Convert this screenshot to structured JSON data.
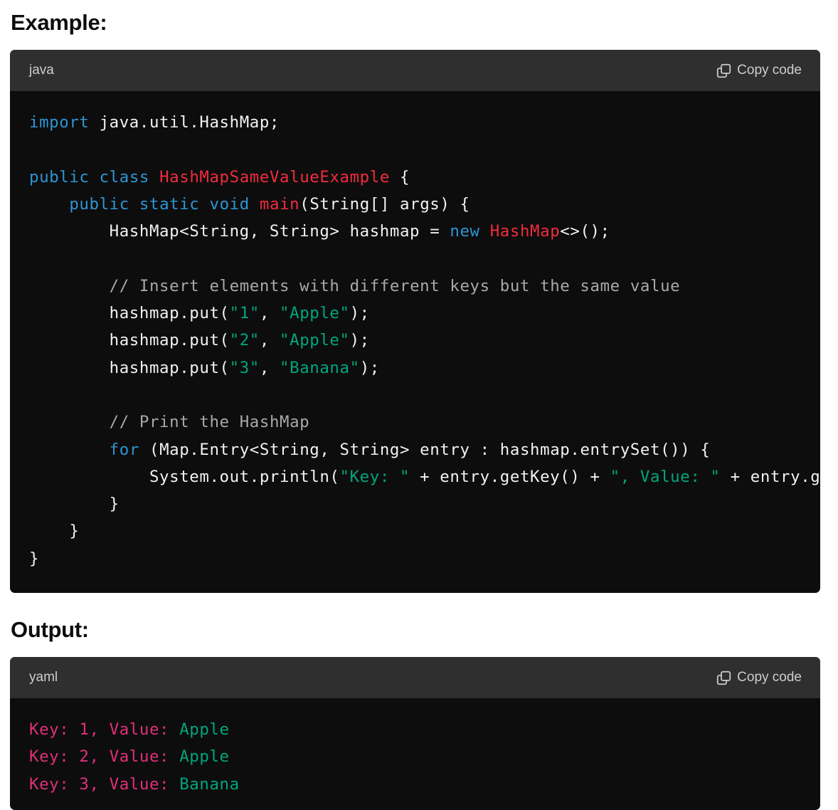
{
  "sections": {
    "example_heading": "Example:",
    "output_heading": "Output:"
  },
  "java_block": {
    "language": "java",
    "copy_label": "Copy code",
    "lines": [
      [
        {
          "t": "import",
          "c": "kw"
        },
        {
          "t": " java.util.HashMap;",
          "c": ""
        }
      ],
      [],
      [
        {
          "t": "public",
          "c": "kw"
        },
        {
          "t": " ",
          "c": ""
        },
        {
          "t": "class",
          "c": "kw"
        },
        {
          "t": " ",
          "c": ""
        },
        {
          "t": "HashMapSameValueExample",
          "c": "cls"
        },
        {
          "t": " {",
          "c": ""
        }
      ],
      [
        {
          "t": "    ",
          "c": ""
        },
        {
          "t": "public",
          "c": "kw"
        },
        {
          "t": " ",
          "c": ""
        },
        {
          "t": "static",
          "c": "kw"
        },
        {
          "t": " ",
          "c": ""
        },
        {
          "t": "void",
          "c": "kw"
        },
        {
          "t": " ",
          "c": ""
        },
        {
          "t": "main",
          "c": "cls"
        },
        {
          "t": "(String[] args) {",
          "c": ""
        }
      ],
      [
        {
          "t": "        HashMap<String, String> hashmap = ",
          "c": ""
        },
        {
          "t": "new",
          "c": "kw"
        },
        {
          "t": " ",
          "c": ""
        },
        {
          "t": "HashMap",
          "c": "cls"
        },
        {
          "t": "<>();",
          "c": ""
        }
      ],
      [],
      [
        {
          "t": "        ",
          "c": ""
        },
        {
          "t": "// Insert elements with different keys but the same value",
          "c": "cmt"
        }
      ],
      [
        {
          "t": "        hashmap.put(",
          "c": ""
        },
        {
          "t": "\"1\"",
          "c": "str"
        },
        {
          "t": ", ",
          "c": ""
        },
        {
          "t": "\"Apple\"",
          "c": "str"
        },
        {
          "t": ");",
          "c": ""
        }
      ],
      [
        {
          "t": "        hashmap.put(",
          "c": ""
        },
        {
          "t": "\"2\"",
          "c": "str"
        },
        {
          "t": ", ",
          "c": ""
        },
        {
          "t": "\"Apple\"",
          "c": "str"
        },
        {
          "t": ");",
          "c": ""
        }
      ],
      [
        {
          "t": "        hashmap.put(",
          "c": ""
        },
        {
          "t": "\"3\"",
          "c": "str"
        },
        {
          "t": ", ",
          "c": ""
        },
        {
          "t": "\"Banana\"",
          "c": "str"
        },
        {
          "t": ");",
          "c": ""
        }
      ],
      [],
      [
        {
          "t": "        ",
          "c": ""
        },
        {
          "t": "// Print the HashMap",
          "c": "cmt"
        }
      ],
      [
        {
          "t": "        ",
          "c": ""
        },
        {
          "t": "for",
          "c": "kw"
        },
        {
          "t": " (Map.Entry<String, String> entry : hashmap.entrySet()) {",
          "c": ""
        }
      ],
      [
        {
          "t": "            System.out.println(",
          "c": ""
        },
        {
          "t": "\"Key: \"",
          "c": "str"
        },
        {
          "t": " + entry.getKey() + ",
          "c": ""
        },
        {
          "t": "\", Value: \"",
          "c": "str"
        },
        {
          "t": " + entry.getVa",
          "c": ""
        }
      ],
      [
        {
          "t": "        }",
          "c": ""
        }
      ],
      [
        {
          "t": "    }",
          "c": ""
        }
      ],
      [
        {
          "t": "}",
          "c": ""
        }
      ]
    ]
  },
  "yaml_block": {
    "language": "yaml",
    "copy_label": "Copy code",
    "lines": [
      [
        {
          "t": "Key: 1, Value:",
          "c": "ykey"
        },
        {
          "t": " ",
          "c": ""
        },
        {
          "t": "Apple",
          "c": "yval"
        }
      ],
      [
        {
          "t": "Key: 2, Value:",
          "c": "ykey"
        },
        {
          "t": " ",
          "c": ""
        },
        {
          "t": "Apple",
          "c": "yval"
        }
      ],
      [
        {
          "t": "Key: 3, Value:",
          "c": "ykey"
        },
        {
          "t": " ",
          "c": ""
        },
        {
          "t": "Banana",
          "c": "yval"
        }
      ]
    ]
  },
  "colors": {
    "keyword": "#2e95d3",
    "class_name": "#f22c3d",
    "string": "#00a67d",
    "comment": "#a9a9a9",
    "yaml_key": "#df3079",
    "code_background": "#0d0d0d",
    "header_background": "#2f2f2f"
  },
  "icons": {
    "copy": "copy-icon"
  }
}
